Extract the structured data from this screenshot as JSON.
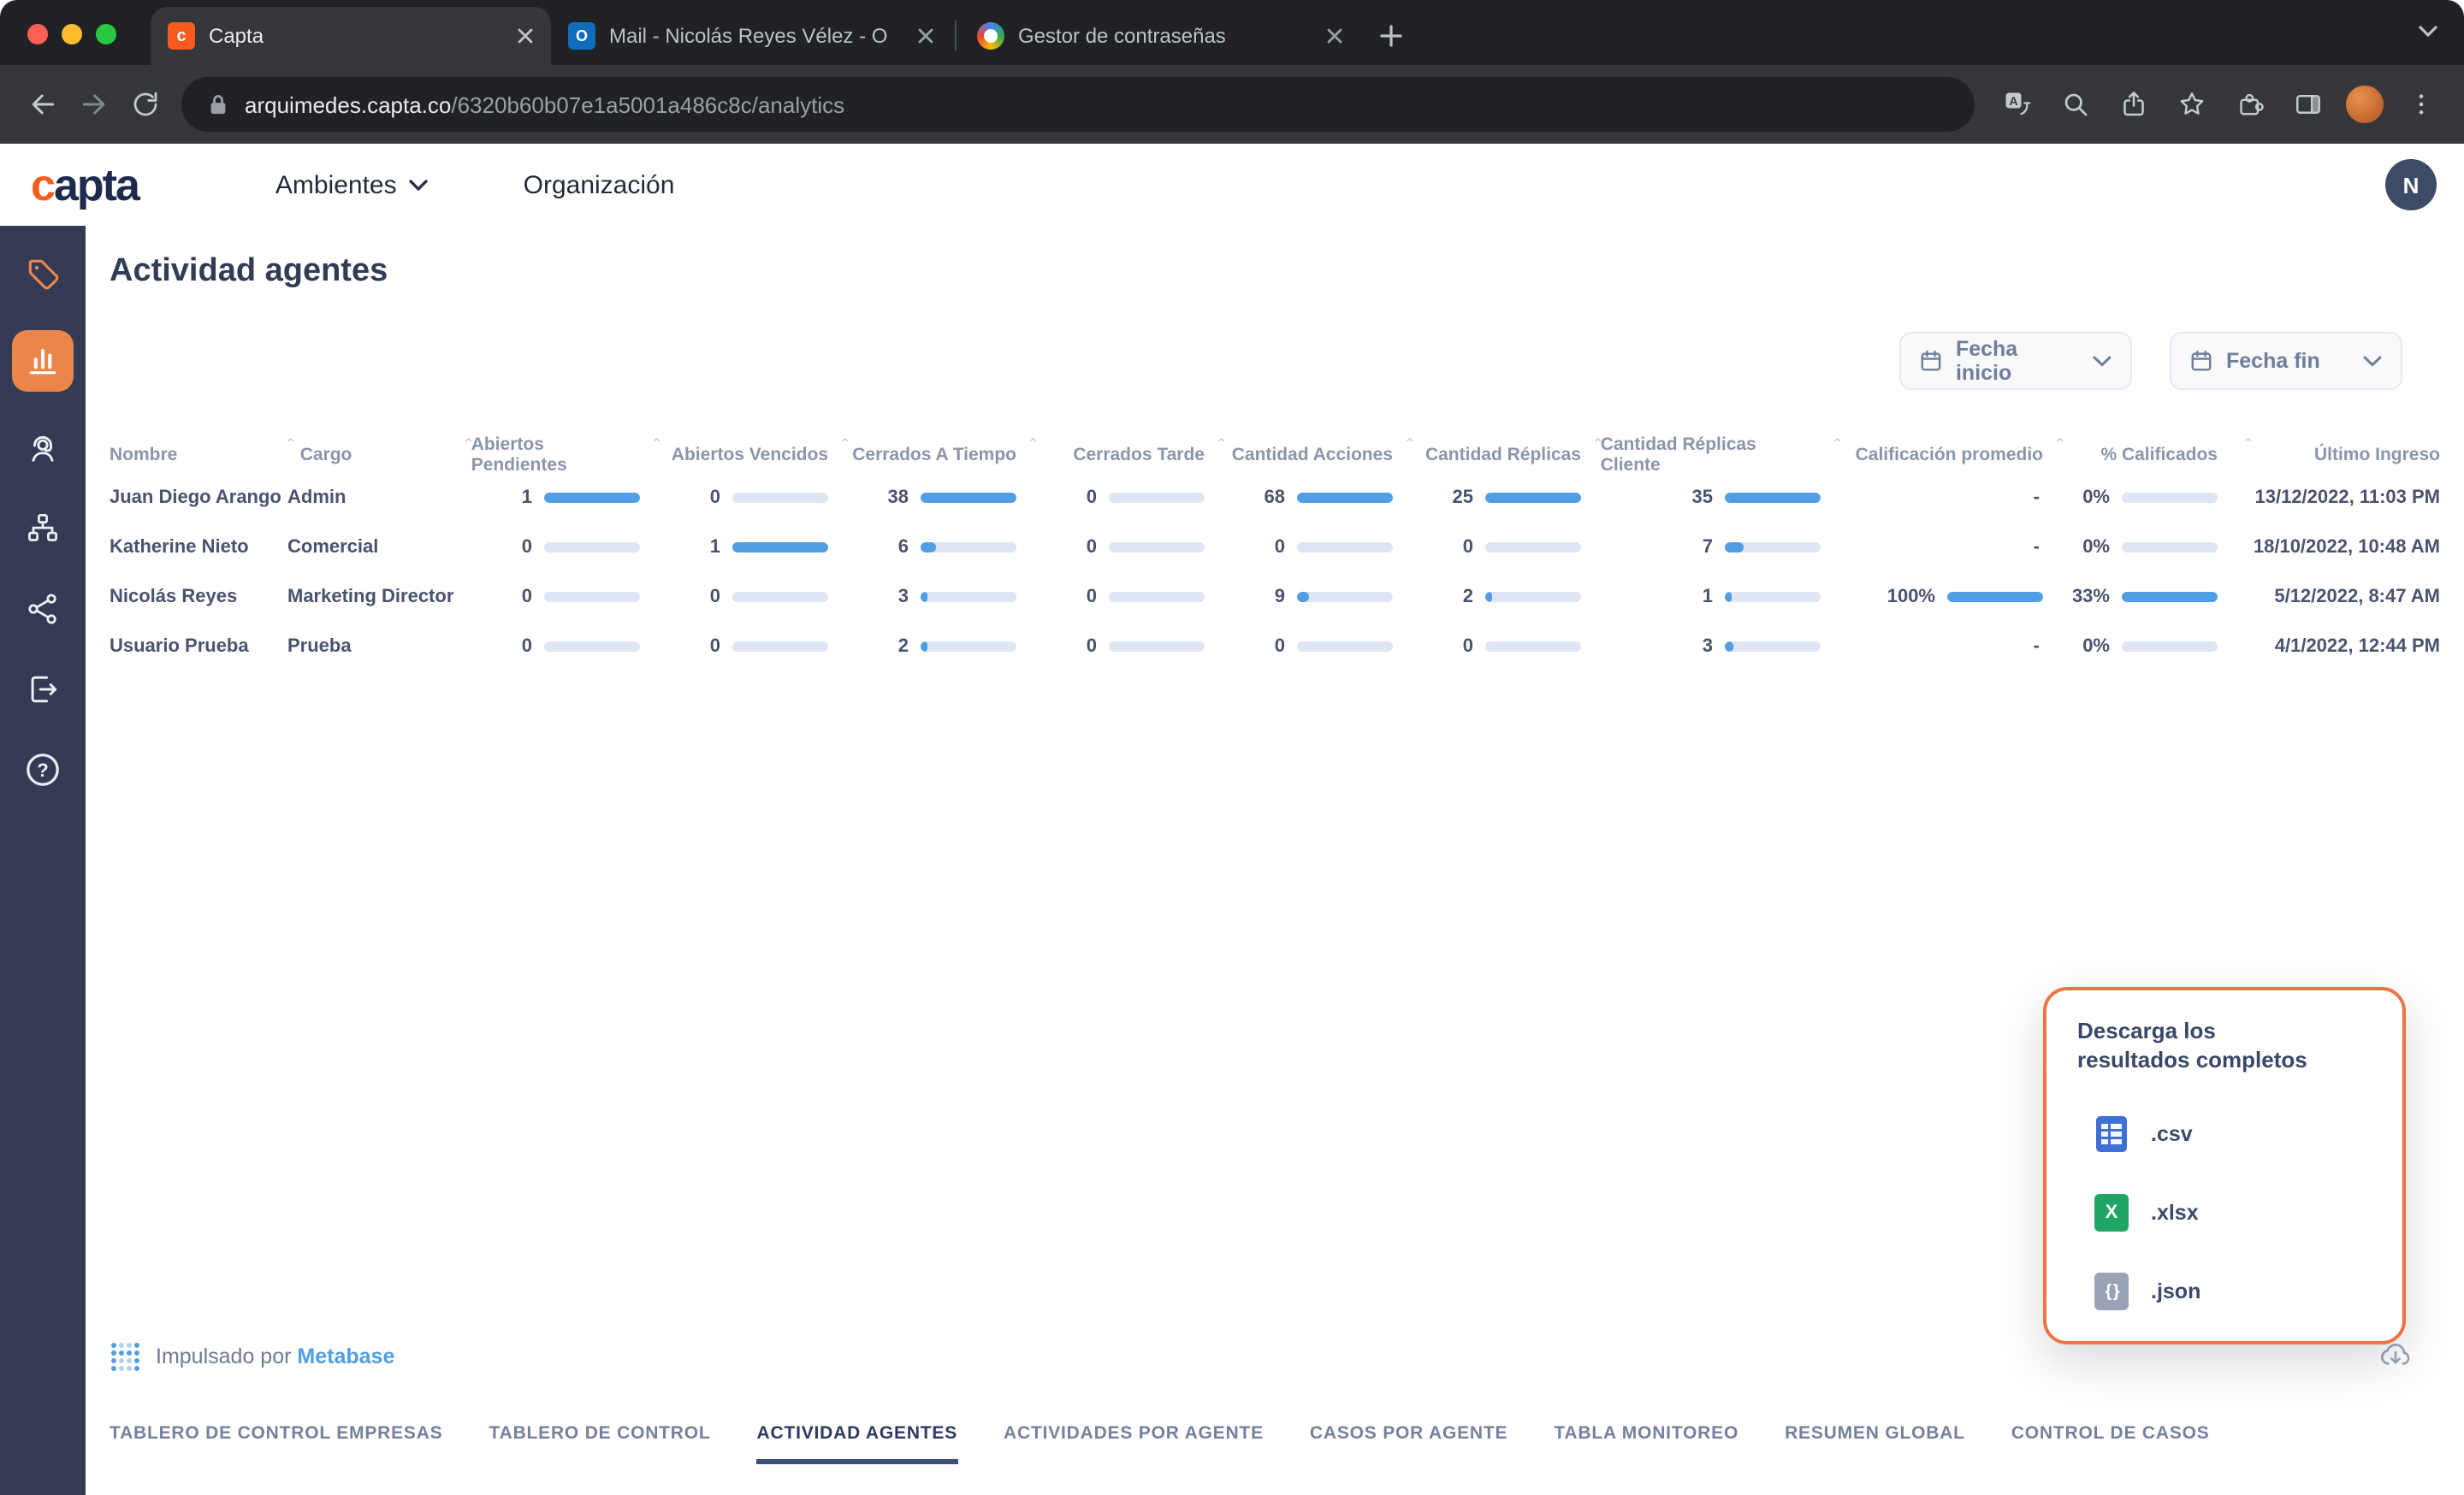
{
  "browser": {
    "tabs": [
      {
        "title": "Capta"
      },
      {
        "title": "Mail - Nicolás Reyes Vélez - O"
      },
      {
        "title": "Gestor de contraseñas"
      }
    ],
    "url": {
      "host": "arquimedes.capta.co",
      "path": "/6320b60b07e1a5001a486c8c/analytics"
    }
  },
  "header": {
    "logo_first": "c",
    "logo_rest": "apta",
    "nav": [
      {
        "label": "Ambientes"
      },
      {
        "label": "Organización"
      }
    ],
    "avatar_initial": "N"
  },
  "sidebar": {
    "icons": [
      "tag-icon",
      "analytics-icon",
      "agents-icon",
      "workflow-icon",
      "network-icon",
      "logout-icon",
      "help-icon"
    ],
    "active": "analytics-icon"
  },
  "page": {
    "title": "Actividad agentes",
    "filters": {
      "start_label": "Fecha inicio",
      "end_label": "Fecha fin"
    }
  },
  "table": {
    "columns": [
      {
        "label": "Nombre",
        "type": "text"
      },
      {
        "label": "Cargo",
        "type": "text"
      },
      {
        "label": "Abiertos Pendientes",
        "type": "bar"
      },
      {
        "label": "Abiertos Vencidos",
        "type": "bar"
      },
      {
        "label": "Cerrados A Tiempo",
        "type": "bar"
      },
      {
        "label": "Cerrados Tarde",
        "type": "bar"
      },
      {
        "label": "Cantidad Acciones",
        "type": "bar"
      },
      {
        "label": "Cantidad Réplicas",
        "type": "bar"
      },
      {
        "label": "Cantidad Réplicas Cliente",
        "type": "bar"
      },
      {
        "label": "Calificación promedio",
        "type": "bar_dash"
      },
      {
        "label": "% Calificados",
        "type": "bar_pct"
      },
      {
        "label": "Último Ingreso",
        "type": "date"
      }
    ],
    "rows": [
      {
        "cells": [
          "Juan Diego Arango",
          "Admin",
          "1",
          "0",
          "38",
          "0",
          "68",
          "25",
          "35",
          "-",
          "0%",
          "13/12/2022, 11:03 PM"
        ]
      },
      {
        "cells": [
          "Katherine Nieto",
          "Comercial",
          "0",
          "1",
          "6",
          "0",
          "0",
          "0",
          "7",
          "-",
          "0%",
          "18/10/2022, 10:48 AM"
        ]
      },
      {
        "cells": [
          "Nicolás Reyes",
          "Marketing Director",
          "0",
          "0",
          "3",
          "0",
          "9",
          "2",
          "1",
          "100%",
          "33%",
          "5/12/2022, 8:47 AM"
        ]
      },
      {
        "cells": [
          "Usuario Prueba",
          "Prueba",
          "0",
          "0",
          "2",
          "0",
          "0",
          "0",
          "3",
          "-",
          "0%",
          "4/1/2022, 12:44 PM"
        ]
      }
    ]
  },
  "download_panel": {
    "title": "Descarga los resultados completos",
    "options": [
      {
        "label": ".csv",
        "icon": "csv-file-icon"
      },
      {
        "label": ".xlsx",
        "icon": "xlsx-file-icon"
      },
      {
        "label": ".json",
        "icon": "json-file-icon"
      }
    ]
  },
  "footer": {
    "powered_by": "Impulsado por",
    "brand": "Metabase",
    "tabs": [
      {
        "label": "TABLERO DE CONTROL EMPRESAS",
        "active": false
      },
      {
        "label": "TABLERO DE CONTROL",
        "active": false
      },
      {
        "label": "ACTIVIDAD AGENTES",
        "active": true
      },
      {
        "label": "ACTIVIDADES POR AGENTE",
        "active": false
      },
      {
        "label": "CASOS POR AGENTE",
        "active": false
      },
      {
        "label": "TABLA MONITOREO",
        "active": false
      },
      {
        "label": "RESUMEN GLOBAL",
        "active": false
      },
      {
        "label": "CONTROL DE CASOS",
        "active": false
      }
    ]
  },
  "colors": {
    "accent_orange": "#ec8648",
    "logo_orange": "#f75c1e",
    "metabase_blue": "#509ee3",
    "sidebar_bg": "#343a53"
  }
}
